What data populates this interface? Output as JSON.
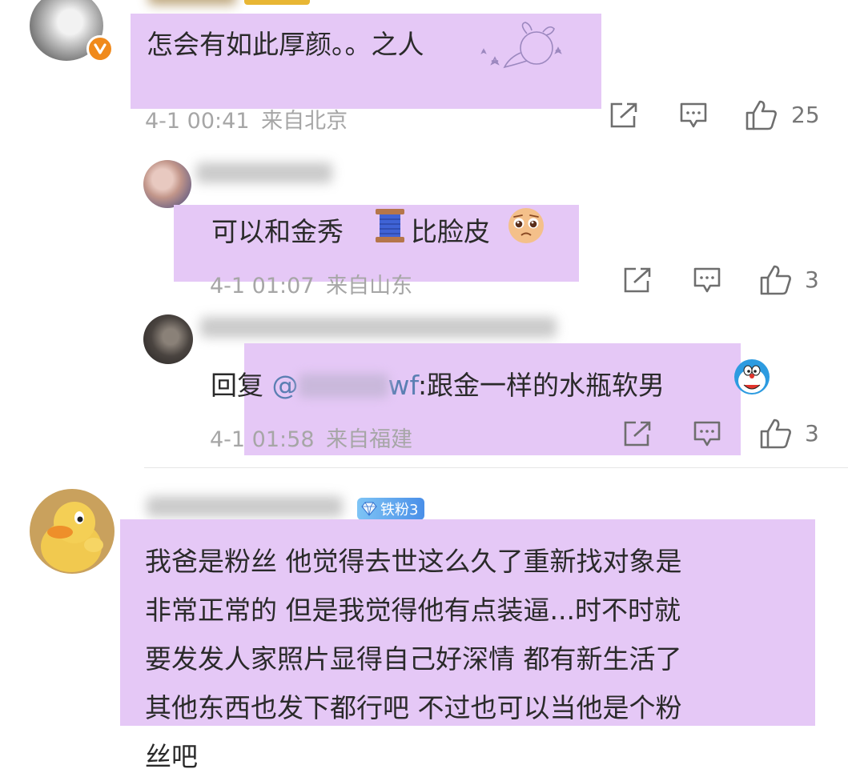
{
  "comments": [
    {
      "text": "怎会有如此厚颜。。之人",
      "time": "4-1 00:41",
      "location": "来自北京",
      "likes": "25"
    },
    {
      "text_a": "可以和金秀",
      "text_b": "比脸皮",
      "time": "4-1 01:07",
      "location": "来自山东",
      "likes": "3"
    },
    {
      "reply_prefix": "回复",
      "mention_at": "@",
      "mention_tail": "wf",
      "text": ":跟金一样的水瓶软男",
      "time": "4-1 01:58",
      "location": "来自福建",
      "likes": "3"
    },
    {
      "badge": "铁粉3",
      "lines": [
        "我爸是粉丝 他觉得去世这么久了重新找对象是",
        "非常正常的 但是我觉得他有点装逼...时不时就",
        "要发发人家照片显得自己好深情 都有新生活了",
        "其他东西也发下都行吧 不过也可以当他是个粉",
        "丝吧"
      ]
    }
  ],
  "colors": {
    "highlight": "#e5c8f6",
    "meta": "#a6a6a6",
    "mention": "#5b7fb3",
    "verified": "#f08a1c",
    "badge_start": "#7ec4f5",
    "badge_end": "#4a8fe8"
  },
  "icons": [
    "verified-badge-icon",
    "share-icon",
    "comment-icon",
    "thumbs-up-icon",
    "spool-emoji",
    "pleading-face-emoji",
    "doraemon-emoji",
    "diamond-icon"
  ]
}
